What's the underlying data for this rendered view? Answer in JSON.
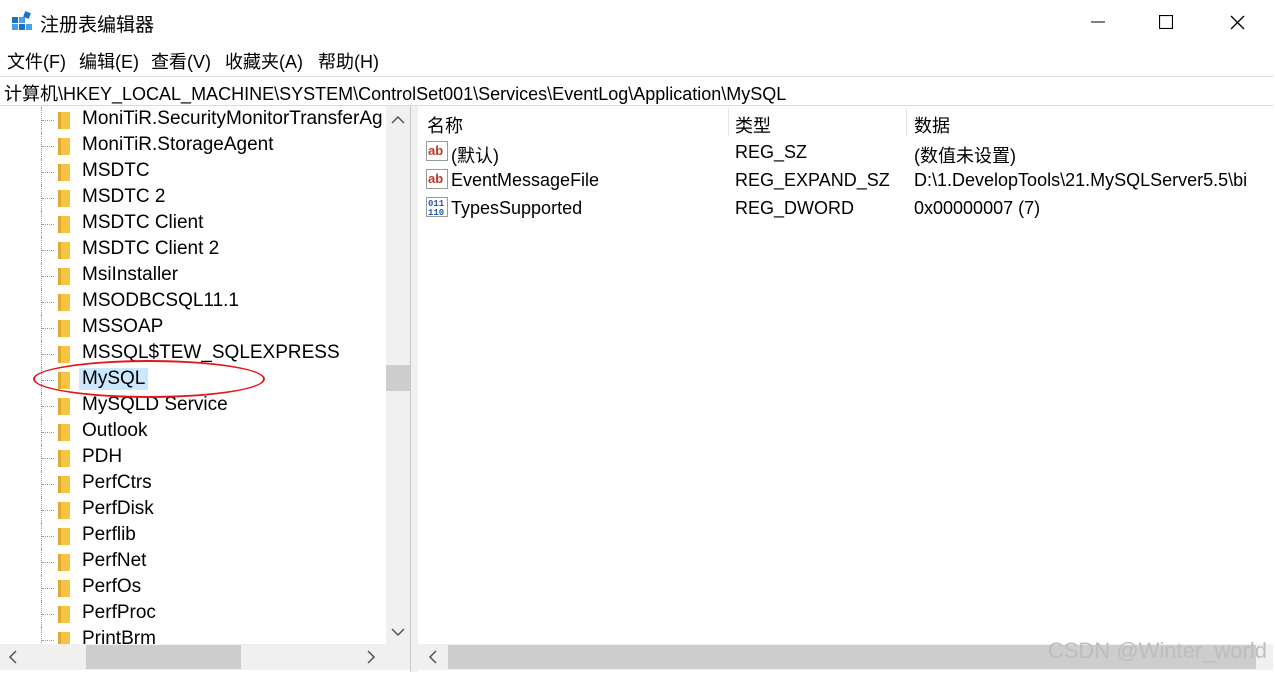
{
  "window": {
    "title": "注册表编辑器",
    "minimize_glyph": "—",
    "maximize_glyph": "☐",
    "close_glyph": "✕"
  },
  "menu": [
    "文件(F)",
    "编辑(E)",
    "查看(V)",
    "收藏夹(A)",
    "帮助(H)"
  ],
  "address": "计算机\\HKEY_LOCAL_MACHINE\\SYSTEM\\ControlSet001\\Services\\EventLog\\Application\\MySQL",
  "tree": {
    "items": [
      "MoniTiR.SecurityMonitorTransferAg",
      "MoniTiR.StorageAgent",
      "MSDTC",
      "MSDTC 2",
      "MSDTC Client",
      "MSDTC Client 2",
      "MsiInstaller",
      "MSODBCSQL11.1",
      "MSSOAP",
      "MSSQL$TEW_SQLEXPRESS",
      "MySQL",
      "MySQLD Service",
      "Outlook",
      "PDH",
      "PerfCtrs",
      "PerfDisk",
      "Perflib",
      "PerfNet",
      "PerfOs",
      "PerfProc",
      "PrintBrm"
    ],
    "selected": "MySQL"
  },
  "list": {
    "columns": [
      "名称",
      "类型",
      "数据"
    ],
    "rows": [
      {
        "icon": "string-value-icon",
        "name": "(默认)",
        "type": "REG_SZ",
        "data": "(数值未设置)"
      },
      {
        "icon": "string-value-icon",
        "name": "EventMessageFile",
        "type": "REG_EXPAND_SZ",
        "data": "D:\\1.DevelopTools\\21.MySQLServer5.5\\bi"
      },
      {
        "icon": "binary-value-icon",
        "name": "TypesSupported",
        "type": "REG_DWORD",
        "data": "0x00000007 (7)"
      }
    ]
  },
  "watermark": "CSDN @Winter_world",
  "colors": {
    "selection": "#cce8ff",
    "folder": "#f5c542",
    "annotation_ellipse": "#e0191e",
    "string_icon": "#c0392b",
    "binary_icon": "#2a5db0"
  }
}
